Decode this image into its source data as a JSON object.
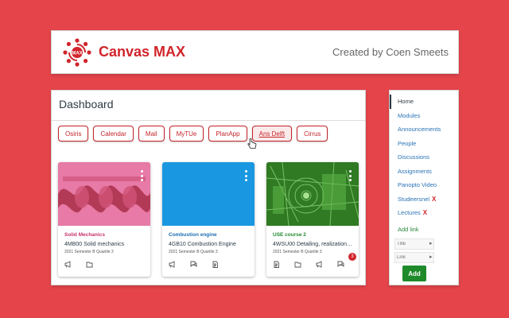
{
  "header": {
    "title": "Canvas MAX",
    "credit": "Created by Coen Smeets",
    "logo_text": "MAX",
    "accent": "#d1242b"
  },
  "dashboard": {
    "title": "Dashboard",
    "quick_links": [
      "Osiris",
      "Calendar",
      "Mail",
      "MyTUe",
      "PlanApp",
      "Ans Delft",
      "Cirrus"
    ],
    "cards": [
      {
        "code": "Solid Mechanics",
        "name": "4MB00 Solid mechanics",
        "term": "2021 Semester B Quartile 3",
        "code_color": "#c7326b",
        "hero_color": "#e66fa0",
        "icons": [
          "announcements-icon",
          "files-icon"
        ]
      },
      {
        "code": "Combustion engine",
        "name": "4GB10 Combustion Engine",
        "term": "2021 Semester B Quartile 3",
        "code_color": "#1b6fb3",
        "hero_color": "#1998e1",
        "icons": [
          "announcements-icon",
          "discussions-icon",
          "assignments-icon"
        ]
      },
      {
        "code": "USE course 2",
        "name": "4WSU00 Detailing, realization…",
        "term": "2021 Semester B Quartile 3",
        "code_color": "#1f8a2a",
        "hero_color": "#3e8d2f",
        "icons": [
          "assignments-icon",
          "files-icon",
          "announcements-icon",
          "discussions-icon"
        ],
        "badge": "3"
      }
    ]
  },
  "sidebar": {
    "items": [
      {
        "label": "Home",
        "active": true,
        "removable": false
      },
      {
        "label": "Modules",
        "active": false,
        "removable": false
      },
      {
        "label": "Announcements",
        "active": false,
        "removable": false
      },
      {
        "label": "People",
        "active": false,
        "removable": false
      },
      {
        "label": "Discussions",
        "active": false,
        "removable": false
      },
      {
        "label": "Assignments",
        "active": false,
        "removable": false
      },
      {
        "label": "Panopto Video",
        "active": false,
        "removable": false
      },
      {
        "label": "Studeersnel",
        "active": false,
        "removable": true
      },
      {
        "label": "Lectures",
        "active": false,
        "removable": true
      }
    ],
    "remove_glyph": "X",
    "add_link_label": "Add link",
    "title_placeholder": "Title",
    "link_placeholder": "Link",
    "add_button": "Add"
  }
}
